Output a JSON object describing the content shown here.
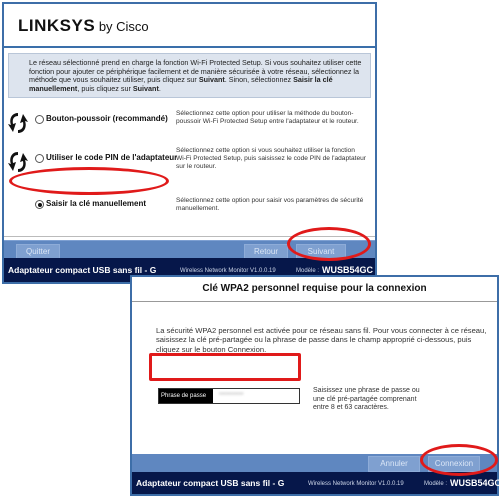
{
  "window1": {
    "brand": "LINKSYS",
    "brand_suffix": "by Cisco",
    "intro_text": "Le réseau sélectionné prend en charge la fonction Wi-Fi Protected Setup. Si vous souhaitez utiliser cette fonction pour ajouter ce périphérique facilement et de manière sécurisée à votre réseau, sélectionnez la méthode que vous souhaitez utiliser, puis cliquez sur",
    "intro_bold1": "Suivant",
    "intro_mid": ". Sinon, sélectionnez",
    "intro_bold2": "Saisir la clé manuellement",
    "intro_mid2": ", puis cliquez sur",
    "intro_bold3": "Suivant",
    "intro_end": ".",
    "options": [
      {
        "label": "Bouton-poussoir (recommandé)",
        "desc": "Sélectionnez cette option pour utiliser la méthode du bouton-poussoir Wi-Fi Protected Setup entre l'adaptateur et le routeur.",
        "selected": false,
        "icon": "wps-icon"
      },
      {
        "label": "Utiliser le code PIN de l'adaptateur",
        "desc": "Sélectionnez cette option si vous souhaitez utiliser la fonction Wi-Fi Protected Setup, puis saisissez le code PIN de l'adaptateur sur le routeur.",
        "selected": false,
        "icon": "wps-icon"
      },
      {
        "label": "Saisir la clé manuellement",
        "desc": "Sélectionnez cette option pour saisir vos paramètres de sécurité manuellement.",
        "selected": true
      }
    ],
    "buttons": {
      "quit": "Quitter",
      "back": "Retour",
      "next": "Suivant"
    },
    "status": {
      "adapter": "Adaptateur compact USB sans fil - G",
      "monitor": "Wireless Network Monitor V1.0.0.19",
      "model_label": "Modèle :",
      "model": "WUSB54GC"
    }
  },
  "window2": {
    "title": "Clé WPA2 personnel requise pour la connexion",
    "message": "La sécurité WPA2 personnel est activée pour ce réseau sans fil. Pour vous connecter à ce réseau, saisissez la clé pré-partagée ou la phrase de passe dans le champ approprié ci-dessous, puis cliquez sur le bouton Connexion.",
    "passphrase_label": "Phrase de passe",
    "passphrase_value": "••••••••••",
    "hint": "Saisissez une phrase de passe ou une clé pré-partagée comprenant entre 8 et 63 caractères.",
    "buttons": {
      "cancel": "Annuler",
      "connect": "Connexion"
    },
    "status": {
      "adapter": "Adaptateur compact USB sans fil - G",
      "monitor": "Wireless Network Monitor V1.0.0.19",
      "model_label": "Modèle :",
      "model": "WUSB54GC"
    }
  },
  "colors": {
    "annotation": "#e01a1a",
    "status_bar": "#06174a",
    "button_bar": "#5f87c0"
  }
}
